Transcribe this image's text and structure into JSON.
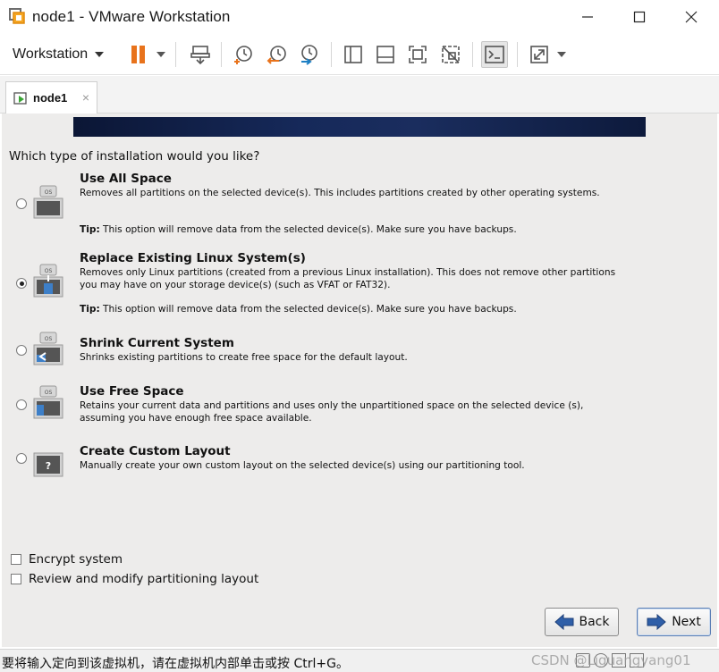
{
  "window": {
    "title": "node1 - VMware Workstation"
  },
  "toolbar": {
    "menu_label": "Workstation",
    "icons": [
      "pause-icon",
      "send-keys-icon",
      "snapshot-icon",
      "revert-snapshot-icon",
      "snapshot-manager-icon",
      "show-library-icon",
      "thumbnail-bar-icon",
      "fullscreen-icon",
      "unity-icon",
      "console-view-icon",
      "stretch-guest-icon"
    ]
  },
  "tabs": [
    {
      "label": "node1",
      "close": "×"
    }
  ],
  "installer": {
    "question": "Which type of installation would you like?",
    "options": [
      {
        "title": "Use All Space",
        "description": "Removes all partitions on the selected device(s).  This includes partitions created by other operating systems.",
        "tip_label": "Tip:",
        "tip_text": " This option will remove data from the selected device(s).  Make sure you have backups.",
        "selected": false,
        "icon": "os-disk-icon"
      },
      {
        "title": "Replace Existing Linux System(s)",
        "description": "Removes only Linux partitions (created from a previous Linux installation).  This does not remove other partitions you may have on your storage device(s) (such as VFAT or FAT32).",
        "tip_label": "Tip:",
        "tip_text": " This option will remove data from the selected device(s).  Make sure you have backups.",
        "selected": true,
        "icon": "os-replace-icon"
      },
      {
        "title": "Shrink Current System",
        "description": "Shrinks existing partitions to create free space for the default layout.",
        "selected": false,
        "icon": "os-shrink-icon"
      },
      {
        "title": "Use Free Space",
        "description": "Retains your current data and partitions and uses only the unpartitioned space on the selected device (s), assuming you have enough free space available.",
        "selected": false,
        "icon": "os-free-space-icon"
      },
      {
        "title": "Create Custom Layout",
        "description": "Manually create your own custom layout on the selected device(s) using our partitioning tool.",
        "selected": false,
        "icon": "custom-layout-icon"
      }
    ],
    "checkboxes": [
      {
        "label": "Encrypt system",
        "checked": false
      },
      {
        "label": "Review and modify partitioning layout",
        "checked": false
      }
    ],
    "back_label": "Back",
    "next_label": "Next"
  },
  "statusbar": {
    "message": "要将输入定向到该虚拟机，请在虚拟机内部单击或按 Ctrl+G。",
    "watermark": "CSDN @Liguangyang01"
  },
  "colors": {
    "guest_background": "#edeceb",
    "banner_dark": "#0b1635",
    "pause_orange": "#e8731c"
  }
}
